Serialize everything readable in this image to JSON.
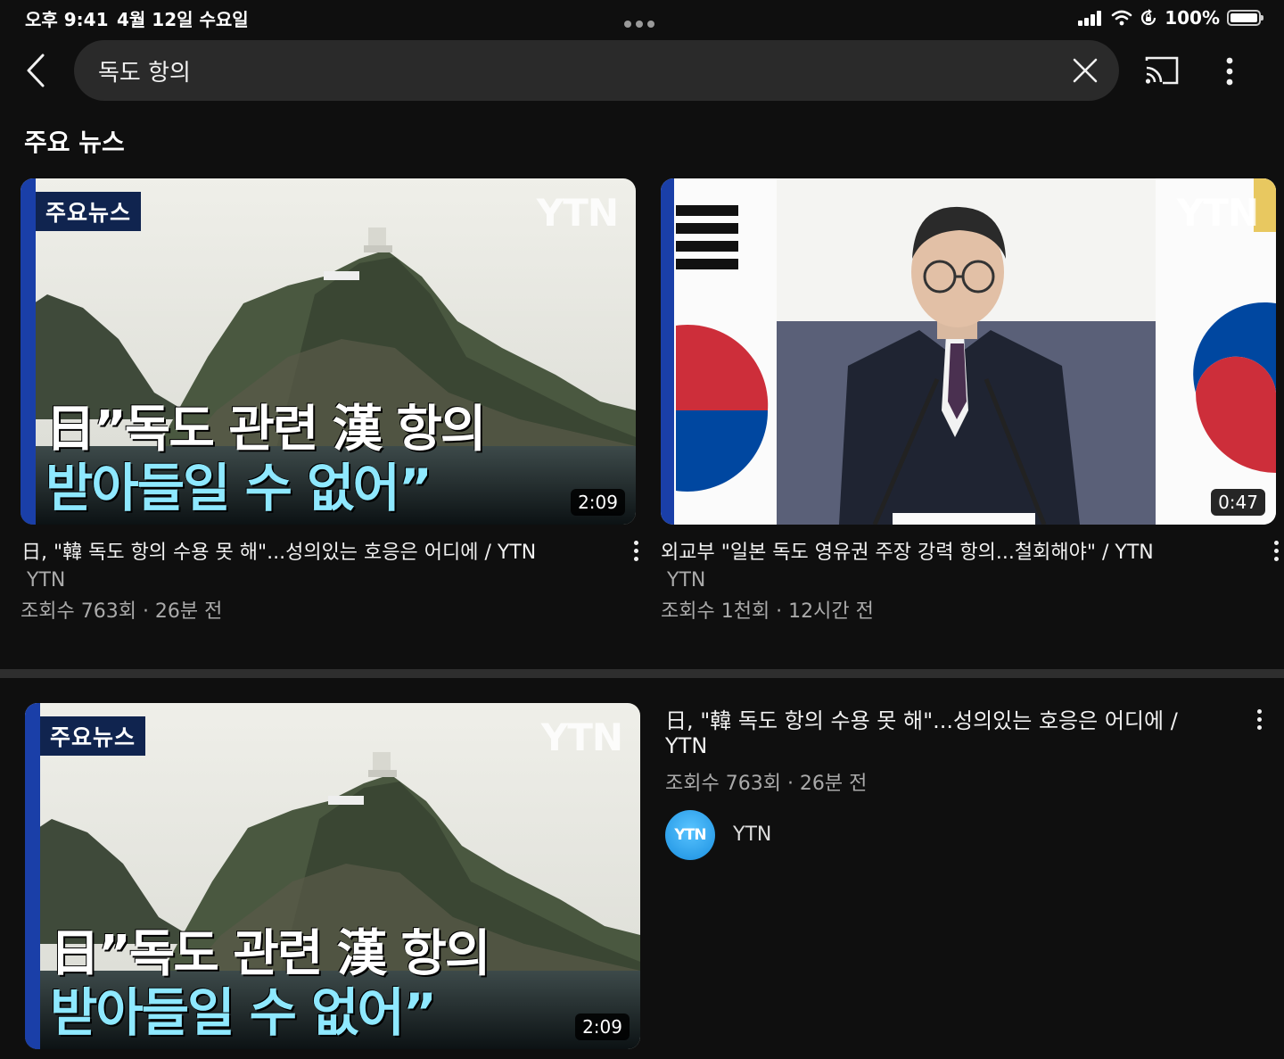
{
  "status_bar": {
    "time": "오후 9:41",
    "date": "4월 12일 수요일",
    "battery": "100%",
    "battery_level": 1.0
  },
  "search": {
    "query": "독도 항의"
  },
  "section": {
    "title": "주요 뉴스"
  },
  "videos": [
    {
      "thumb_tag": "주요뉴스",
      "thumb_logo": "YTN",
      "thumb_caption_line1": "日”독도 관련 漢 항의",
      "thumb_caption_line2": "받아들일 수 없어”",
      "duration": "2:09",
      "title": "日, \"韓 독도 항의 수용 못 해\"...성의있는 호응은 어디에 / YTN",
      "channel": "YTN",
      "meta": "조회수 763회 · 26분 전"
    },
    {
      "thumb_logo": "YTN",
      "duration": "0:47",
      "title": "외교부 \"일본 독도 영유권 주장 강력 항의...철회해야\" / YTN",
      "channel": "YTN",
      "meta": "조회수 1천회 · 12시간 전"
    }
  ],
  "featured": {
    "thumb_tag": "주요뉴스",
    "thumb_logo": "YTN",
    "thumb_caption_line1": "日”독도 관련 漢 항의",
    "thumb_caption_line2": "받아들일 수 없어”",
    "duration": "2:09",
    "title_line1": "日, \"韓 독도 항의 수용 못 해\"...성의있는 호응은 어디에 /",
    "title_line2": "YTN",
    "meta": "조회수 763회 · 26분 전",
    "channel": "YTN",
    "avatar_text": "YTN"
  },
  "colors": {
    "background": "#0f0f0f",
    "search_bg": "#2a2a2a",
    "caption_cyan": "#8ee8ff",
    "tag_navy": "#10244f"
  }
}
